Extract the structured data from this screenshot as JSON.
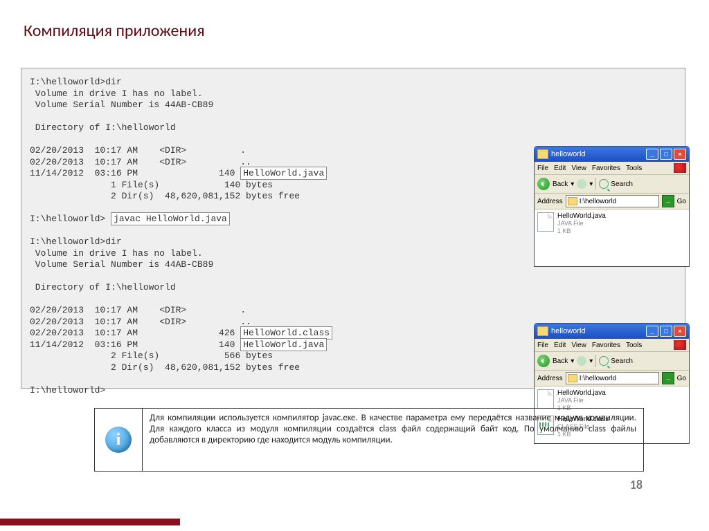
{
  "title": "Компиляция приложения",
  "console": {
    "line1": "I:\\helloworld>dir",
    "line2": " Volume in drive I has no label.",
    "line3": " Volume Serial Number is 44AB-CB89",
    "line4": "",
    "line5": " Directory of I:\\helloworld",
    "line6": "",
    "line7": "02/20/2013  10:17 AM    <DIR>          .",
    "line8": "02/20/2013  10:17 AM    <DIR>          ..",
    "line9a": "11/14/2012  03:16 PM               140 ",
    "hl1": "HelloWorld.java",
    "line10": "               1 File(s)            140 bytes",
    "line11": "               2 Dir(s)  48,620,081,152 bytes free",
    "line12": "",
    "line13a": "I:\\helloworld> ",
    "hl2": "javac HelloWorld.java",
    "line14": "",
    "line15": "I:\\helloworld>dir",
    "line16": " Volume in drive I has no label.",
    "line17": " Volume Serial Number is 44AB-CB89",
    "line18": "",
    "line19": " Directory of I:\\helloworld",
    "line20": "",
    "line21": "02/20/2013  10:17 AM    <DIR>          .",
    "line22": "02/20/2013  10:17 AM    <DIR>          ..",
    "line23a": "02/20/2013  10:17 AM               426 ",
    "hl3": "HelloWorld.class",
    "line24a": "11/14/2012  03:16 PM               140 ",
    "hl4": "HelloWorld.java",
    "line25": "               2 File(s)            566 bytes",
    "line26": "               2 Dir(s)  48,620,081,152 bytes free",
    "line27": "",
    "line28": "I:\\helloworld>"
  },
  "explorer": {
    "title": "helloworld",
    "menu": {
      "file": "File",
      "edit": "Edit",
      "view": "View",
      "fav": "Favorites",
      "tools": "Tools"
    },
    "back": "Back",
    "search": "Search",
    "addressLabel": "Address",
    "addressValue": "I:\\helloworld",
    "go": "Go"
  },
  "files1": [
    {
      "name": "HelloWorld.java",
      "type": "JAVA File",
      "size": "1 KB"
    }
  ],
  "files2": [
    {
      "name": "HelloWorld.java",
      "type": "JAVA File",
      "size": "1 KB"
    },
    {
      "name": "HelloWorld.class",
      "type": "CLASS File",
      "size": "1 KB"
    }
  ],
  "desc": "Для компиляции используется компилятор javac.exe. В качестве параметра ему передаётся название модуля компиляции. Для каждого класса из модуля компиляции создаётся class файл содержащий байт код. По умолчанию class файлы добавляются в директорию где находится модуль компиляции.",
  "pageNumber": "18"
}
